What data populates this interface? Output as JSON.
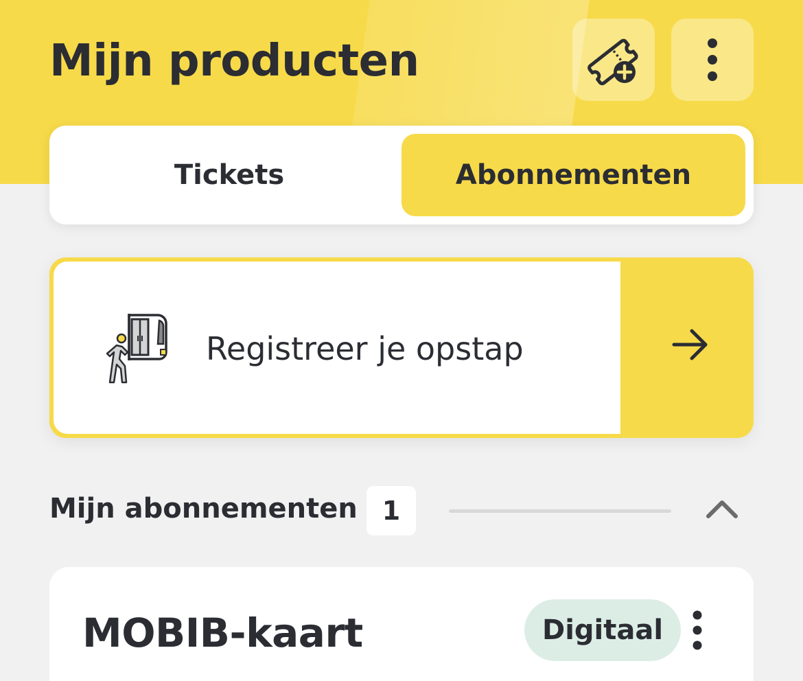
{
  "header": {
    "title": "Mijn producten",
    "buy_ticket_icon": "ticket-add-icon",
    "more_icon": "more-vertical-icon",
    "background_color": "#f7da49"
  },
  "tabs": [
    {
      "label": "Tickets",
      "selected": false
    },
    {
      "label": "Abonnementen",
      "selected": true
    }
  ],
  "register": {
    "label": "Registreer je opstap",
    "illustration": "person-boarding-vehicle-icon",
    "arrow_icon": "arrow-right-icon"
  },
  "section": {
    "title": "Mijn abonnementen",
    "count": "1",
    "collapse_icon": "chevron-up-icon"
  },
  "products": [
    {
      "name": "MOBIB-kaart",
      "badge": "Digitaal",
      "badge_color": "#dcede6",
      "more_icon": "more-vertical-icon"
    }
  ]
}
